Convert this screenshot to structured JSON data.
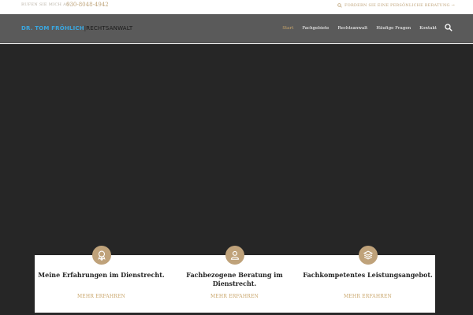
{
  "topbar": {
    "call_label": "Rufen Sie mich an:",
    "phone": "030-8048-4942",
    "consult_label": "Fordern Sie eine persönliche Beratung →"
  },
  "logo": {
    "name": "DR. TOM FRÖHLICH",
    "separator": "|",
    "subtitle": "RECHTSANWALT"
  },
  "nav": {
    "items": [
      {
        "label": "Start",
        "active": true
      },
      {
        "label": "Fachgebiete",
        "active": false
      },
      {
        "label": "Rechtsanwalt",
        "active": false
      },
      {
        "label": "Häufige Fragen",
        "active": false
      },
      {
        "label": "Kontakt",
        "active": false
      }
    ]
  },
  "features": [
    {
      "title": "Meine Erfahrungen im Dienstrecht.",
      "link": "MEHR ERFAHREN",
      "icon": "award-ribbon-icon"
    },
    {
      "title": "Fachbezogene Beratung im Dienstrecht.",
      "link": "MEHR ERFAHREN",
      "icon": "user-profile-icon"
    },
    {
      "title": "Fachkompetentes Leistungsangebot.",
      "link": "MEHR ERFAHREN",
      "icon": "layers-stack-icon"
    }
  ],
  "colors": {
    "accent_gold": "#bfa27a",
    "logo_blue": "#3aa7e0",
    "nav_bg": "#5a5a5a",
    "hero_bg": "#262626"
  }
}
